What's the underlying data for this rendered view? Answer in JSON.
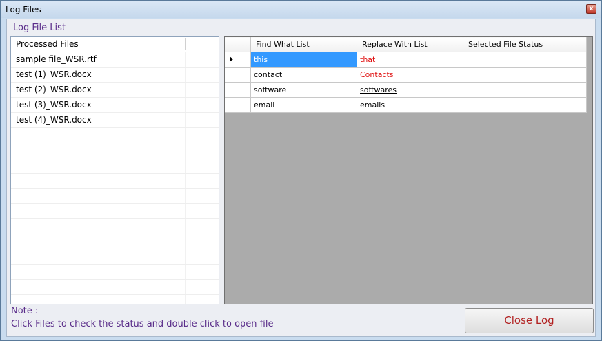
{
  "window": {
    "title": "Log Files",
    "close_glyph": "x"
  },
  "group": {
    "title": "Log File List"
  },
  "processed_files": {
    "header": "Processed Files",
    "items": [
      "sample file_WSR.rtf",
      "test (1)_WSR.docx",
      "test (2)_WSR.docx",
      "test (3)_WSR.docx",
      "test (4)_WSR.docx"
    ]
  },
  "grid": {
    "columns": [
      "Find What List",
      "Replace With List",
      "Selected File Status"
    ],
    "rows": [
      {
        "find": "this",
        "replace": "that",
        "status": ""
      },
      {
        "find": "contact",
        "replace": "Contacts",
        "status": ""
      },
      {
        "find": "software",
        "replace": "softwares",
        "status": ""
      },
      {
        "find": "email",
        "replace": "emails",
        "status": ""
      }
    ]
  },
  "note": {
    "label": "Note :",
    "text": "Click Files to check the status and double click to open file"
  },
  "buttons": {
    "close_log": "Close Log"
  },
  "colors": {
    "accent_purple": "#5a2d8a",
    "selection_blue": "#3399ff",
    "replace_red": "#e01010",
    "close_log_text": "#b22222"
  }
}
